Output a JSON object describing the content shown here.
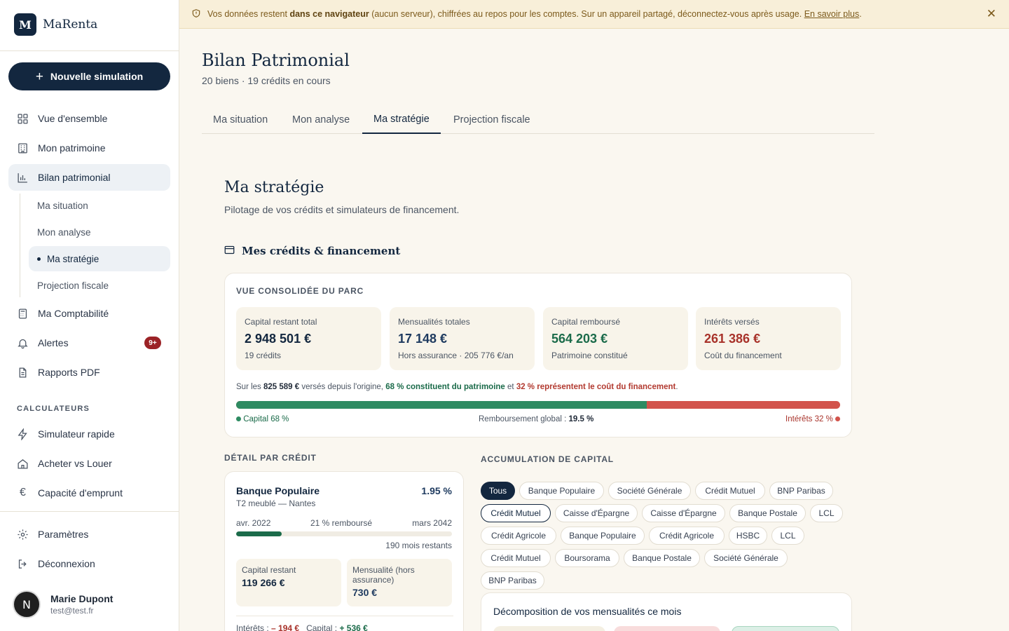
{
  "app": {
    "logo_letter": "M",
    "name": "MaRenta"
  },
  "sidebar": {
    "new_simulation": "Nouvelle simulation",
    "nav": [
      {
        "label": "Vue d'ensemble",
        "icon": "grid-icon"
      },
      {
        "label": "Mon patrimoine",
        "icon": "building-icon"
      },
      {
        "label": "Bilan patrimonial",
        "icon": "bar-chart-icon"
      }
    ],
    "sub": [
      "Ma situation",
      "Mon analyse",
      "Ma stratégie",
      "Projection fiscale"
    ],
    "nav2": [
      {
        "label": "Ma Comptabilité",
        "icon": "calculator-icon"
      },
      {
        "label": "Alertes",
        "icon": "bell-icon",
        "badge": "9+"
      },
      {
        "label": "Rapports PDF",
        "icon": "document-icon"
      }
    ],
    "section_calc": "CALCULATEURS",
    "calc": [
      {
        "label": "Simulateur rapide",
        "icon": "lightning-icon"
      },
      {
        "label": "Acheter vs Louer",
        "icon": "home-icon"
      },
      {
        "label": "Capacité d'emprunt",
        "icon": "euro-icon"
      }
    ],
    "bottom": [
      {
        "label": "Paramètres",
        "icon": "gear-icon"
      },
      {
        "label": "Déconnexion",
        "icon": "logout-icon"
      }
    ],
    "user": {
      "initial": "N",
      "name": "Marie Dupont",
      "email": "test@test.fr"
    }
  },
  "banner": {
    "text_1": "Vos données restent",
    "bold": "dans ce navigateur",
    "text_2": "(aucun serveur), chiffrées au repos pour les comptes. Sur un appareil partagé, déconnectez-vous après usage.",
    "link": "En savoir plus",
    "end": ".",
    "close": "✕"
  },
  "header": {
    "title": "Bilan Patrimonial",
    "subtitle": "20 biens · 19 crédits en cours",
    "tabs": [
      "Ma situation",
      "Mon analyse",
      "Ma stratégie",
      "Projection fiscale"
    ]
  },
  "strategy": {
    "title": "Ma stratégie",
    "subtitle": "Pilotage de vos crédits et simulateurs de financement.",
    "section": "Mes crédits & financement"
  },
  "consolidated": {
    "label": "VUE CONSOLIDÉE DU PARC",
    "kpis": [
      {
        "label": "Capital restant total",
        "value": "2 948 501 €",
        "sub": "19 crédits",
        "color": "#13273f"
      },
      {
        "label": "Mensualités totales",
        "value": "17 148 €",
        "sub": "Hors assurance · 205 776 €/an",
        "color": "#1e3a5f"
      },
      {
        "label": "Capital remboursé",
        "value": "564 203 €",
        "sub": "Patrimoine constitué",
        "color": "#1b6b4a"
      },
      {
        "label": "Intérêts versés",
        "value": "261 386 €",
        "sub": "Coût du financement",
        "color": "#a8322a"
      }
    ],
    "summary": {
      "p1": "Sur les",
      "total": "825 589 €",
      "p2": "versés depuis l'origine,",
      "green": "68 % constituent du patrimoine",
      "p3": "et",
      "red": "32 % représentent le coût du financement",
      "p4": "."
    },
    "capital_share": 68,
    "legend_capital": "Capital 68 %",
    "legend_global_label": "Remboursement global :",
    "legend_global_value": "19.5 %",
    "legend_interest": "Intérêts 32 %",
    "colors": {
      "capital": "#2e8b62",
      "interest": "#d2534b"
    }
  },
  "detail": {
    "label": "DÉTAIL PAR CRÉDIT",
    "bank": "Banque Populaire",
    "rate": "1.95 %",
    "property": "T2 meublé — Nantes",
    "start": "avr. 2022",
    "progress_label": "21 % remboursé",
    "progress": 21,
    "end": "mars 2042",
    "remaining": "190 mois restants",
    "capital_label": "Capital restant",
    "capital_value": "119 266 €",
    "monthly_label": "Mensualité (hors assurance)",
    "monthly_value": "730 €",
    "interest_label": "Intérêts :",
    "interest_value": "– 194 €",
    "capital_part_label": "Capital :",
    "capital_part_value": "+ 536 €"
  },
  "accumulation": {
    "label": "ACCUMULATION DE CAPITAL",
    "chips": [
      "Tous",
      "Banque Populaire",
      "Société Générale",
      "Crédit Mutuel",
      "BNP Paribas",
      "Crédit Mutuel",
      "Caisse d'Épargne",
      "Caisse d'Épargne",
      "Banque Postale",
      "LCL",
      "Crédit Agricole",
      "Banque Populaire",
      "Crédit Agricole",
      "HSBC",
      "LCL",
      "Crédit Mutuel",
      "Boursorama",
      "Banque Postale",
      "Société Générale",
      "BNP Paribas"
    ],
    "decomp_title": "Décomposition de vos mensualités ce mois"
  }
}
